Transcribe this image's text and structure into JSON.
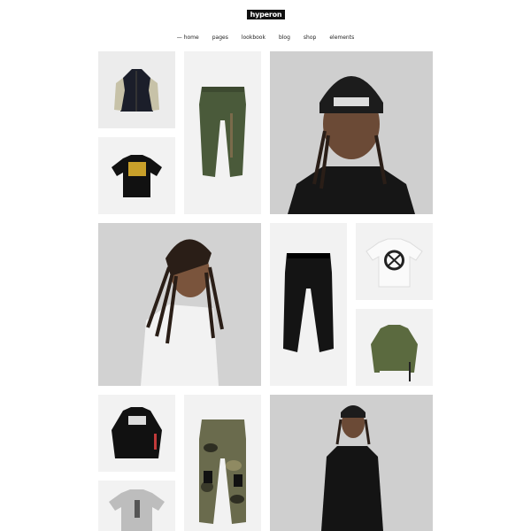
{
  "brand": {
    "logo_text": "hyperon"
  },
  "nav": {
    "items": [
      {
        "label": "home",
        "active": true
      },
      {
        "label": "pages"
      },
      {
        "label": "lookbook"
      },
      {
        "label": "blog"
      },
      {
        "label": "shop"
      },
      {
        "label": "elements"
      }
    ]
  },
  "gallery": {
    "tiles": [
      {
        "name": "jacket-tile",
        "icon": "jacket-icon"
      },
      {
        "name": "green-sweatpants-tile",
        "icon": "sweatpants-icon"
      },
      {
        "name": "model-beanie-photo",
        "icon": "model-photo"
      },
      {
        "name": "black-graphic-tee-tile",
        "icon": "tshirt-icon"
      },
      {
        "name": "model-dreadlocks-photo",
        "icon": "model-photo"
      },
      {
        "name": "black-sweatpants-tile",
        "icon": "sweatpants-icon"
      },
      {
        "name": "white-logo-tee-tile",
        "icon": "tshirt-icon"
      },
      {
        "name": "olive-longsleeve-tile",
        "icon": "longsleeve-icon"
      },
      {
        "name": "black-longsleeve-tile",
        "icon": "longsleeve-icon"
      },
      {
        "name": "camo-pants-tile",
        "icon": "cargo-pants-icon"
      },
      {
        "name": "model-black-outfit-photo",
        "icon": "model-photo"
      },
      {
        "name": "grey-tee-tile",
        "icon": "tshirt-icon"
      }
    ]
  },
  "colors": {
    "tile_bg": "#ececec",
    "photo_bg": "#d8d8d8",
    "olive": "#5b6a3f",
    "army_green": "#4a5a3a",
    "black": "#111111"
  }
}
